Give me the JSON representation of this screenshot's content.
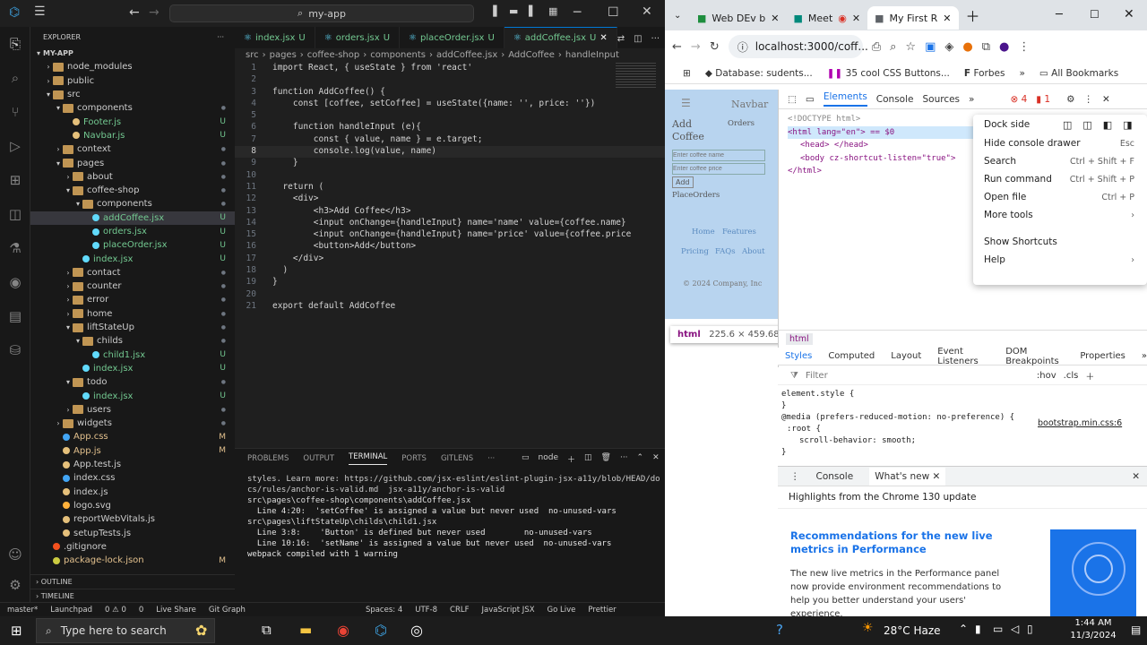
{
  "vscode": {
    "title": "my-app",
    "explorer_label": "EXPLORER",
    "root": "MY-APP",
    "tree": [
      {
        "label": "node_modules",
        "indent": 1,
        "type": "folder",
        "open": false,
        "status": ""
      },
      {
        "label": "public",
        "indent": 1,
        "type": "folder",
        "open": false,
        "status": ""
      },
      {
        "label": "src",
        "indent": 1,
        "type": "folder",
        "open": true,
        "status": ""
      },
      {
        "label": "components",
        "indent": 2,
        "type": "folder",
        "open": true,
        "status": ""
      },
      {
        "label": "Footer.js",
        "indent": 3,
        "type": "js",
        "status": "U"
      },
      {
        "label": "Navbar.js",
        "indent": 3,
        "type": "js",
        "status": "U"
      },
      {
        "label": "context",
        "indent": 2,
        "type": "folder",
        "open": false,
        "status": ""
      },
      {
        "label": "pages",
        "indent": 2,
        "type": "folder",
        "open": true,
        "status": ""
      },
      {
        "label": "about",
        "indent": 3,
        "type": "folder",
        "open": false,
        "status": ""
      },
      {
        "label": "coffee-shop",
        "indent": 3,
        "type": "folder",
        "open": true,
        "status": ""
      },
      {
        "label": "components",
        "indent": 4,
        "type": "folder",
        "open": true,
        "status": ""
      },
      {
        "label": "addCoffee.jsx",
        "indent": 5,
        "type": "jsx",
        "status": "U",
        "selected": true
      },
      {
        "label": "orders.jsx",
        "indent": 5,
        "type": "jsx",
        "status": "U"
      },
      {
        "label": "placeOrder.jsx",
        "indent": 5,
        "type": "jsx",
        "status": "U"
      },
      {
        "label": "index.jsx",
        "indent": 4,
        "type": "jsx",
        "status": "U"
      },
      {
        "label": "contact",
        "indent": 3,
        "type": "folder",
        "open": false,
        "status": ""
      },
      {
        "label": "counter",
        "indent": 3,
        "type": "folder",
        "open": false,
        "status": ""
      },
      {
        "label": "error",
        "indent": 3,
        "type": "folder",
        "open": false,
        "status": ""
      },
      {
        "label": "home",
        "indent": 3,
        "type": "folder",
        "open": false,
        "status": ""
      },
      {
        "label": "liftStateUp",
        "indent": 3,
        "type": "folder",
        "open": true,
        "status": ""
      },
      {
        "label": "childs",
        "indent": 4,
        "type": "folder",
        "open": true,
        "status": ""
      },
      {
        "label": "child1.jsx",
        "indent": 5,
        "type": "jsx",
        "status": "U"
      },
      {
        "label": "index.jsx",
        "indent": 4,
        "type": "jsx",
        "status": "U"
      },
      {
        "label": "todo",
        "indent": 3,
        "type": "folder",
        "open": true,
        "status": ""
      },
      {
        "label": "index.jsx",
        "indent": 4,
        "type": "jsx",
        "status": "U"
      },
      {
        "label": "users",
        "indent": 3,
        "type": "folder",
        "open": false,
        "status": ""
      },
      {
        "label": "widgets",
        "indent": 2,
        "type": "folder",
        "open": false,
        "status": ""
      },
      {
        "label": "App.css",
        "indent": 2,
        "type": "css",
        "status": "M"
      },
      {
        "label": "App.js",
        "indent": 2,
        "type": "js",
        "status": "M"
      },
      {
        "label": "App.test.js",
        "indent": 2,
        "type": "js",
        "status": ""
      },
      {
        "label": "index.css",
        "indent": 2,
        "type": "css",
        "status": ""
      },
      {
        "label": "index.js",
        "indent": 2,
        "type": "js",
        "status": ""
      },
      {
        "label": "logo.svg",
        "indent": 2,
        "type": "svg",
        "status": ""
      },
      {
        "label": "reportWebVitals.js",
        "indent": 2,
        "type": "js",
        "status": ""
      },
      {
        "label": "setupTests.js",
        "indent": 2,
        "type": "js",
        "status": ""
      },
      {
        "label": ".gitignore",
        "indent": 1,
        "type": "git",
        "status": ""
      },
      {
        "label": "package-lock.json",
        "indent": 1,
        "type": "json",
        "status": "M"
      }
    ],
    "outline": "OUTLINE",
    "timeline": "TIMELINE",
    "tabs": [
      {
        "label": "index.jsx",
        "status": "U",
        "active": false
      },
      {
        "label": "orders.jsx",
        "status": "U",
        "active": false
      },
      {
        "label": "placeOrder.jsx",
        "status": "U",
        "active": false
      },
      {
        "label": "addCoffee.jsx",
        "status": "U",
        "active": true
      }
    ],
    "breadcrumbs": [
      "src",
      "pages",
      "coffee-shop",
      "components",
      "addCoffee.jsx",
      "AddCoffee",
      "handleInput"
    ],
    "code": [
      "import React, { useState } from 'react'",
      "",
      "function AddCoffee() {",
      "    const [coffee, setCoffee] = useState({name: '', price: ''})",
      "",
      "    function handleInput (e){",
      "        const { value, name } = e.target;",
      "        console.log(value, name)",
      "    }",
      "",
      "  return (",
      "    <div>",
      "        <h3>Add Coffee</h3>",
      "        <input onChange={handleInput} name='name' value={coffee.name}",
      "        <input onChange={handleInput} name='price' value={coffee.price",
      "        <button>Add</button>",
      "    </div>",
      "  )",
      "}",
      "",
      "export default AddCoffee"
    ],
    "panel_tabs": [
      "PROBLEMS",
      "OUTPUT",
      "TERMINAL",
      "PORTS",
      "GITLENS"
    ],
    "terminal_shell": "node",
    "terminal_lines": [
      "styles. Learn more: https://github.com/jsx-eslint/eslint-plugin-jsx-a11y/blob/HEAD/do",
      "cs/rules/anchor-is-valid.md  jsx-a11y/anchor-is-valid",
      "",
      "src\\pages\\coffee-shop\\components\\addCoffee.jsx",
      "  Line 4:20:  'setCoffee' is assigned a value but never used  no-unused-vars",
      "",
      "src\\pages\\liftStateUp\\childs\\child1.jsx",
      "  Line 3:8:    'Button' is defined but never used        no-unused-vars",
      "  Line 10:16:  'setName' is assigned a value but never used  no-unused-vars",
      "",
      "webpack compiled with 1 warning"
    ],
    "status": [
      "master*",
      "Launchpad",
      "0 ⚠ 0",
      "0",
      "Live Share",
      "Git Graph",
      "Spaces: 4",
      "UTF-8",
      "CRLF",
      "JavaScript JSX",
      "Go Live",
      "Prettier"
    ]
  },
  "chrome": {
    "tabs": [
      {
        "label": "Web DEv b",
        "active": false,
        "color": "#1e8e3e"
      },
      {
        "label": "Meet",
        "active": false,
        "color": "#00897b"
      },
      {
        "label": "My First R",
        "active": true,
        "color": "#5f6368"
      }
    ],
    "url": "localhost:3000/coff...",
    "bookmarks": [
      "Database: sudents...",
      "35 cool CSS Buttons...",
      "Forbes",
      "All Bookmarks"
    ],
    "app_page": {
      "navbar": "Navbar",
      "add_heading": "Add Coffee",
      "orders": "Orders",
      "name_placeholder": "Enter coffee name",
      "price_placeholder": "Enter coffee price",
      "add_button": "Add",
      "place_orders": "PlaceOrders",
      "footer_links": [
        "Home",
        "Features",
        "Pricing",
        "FAQs",
        "About"
      ],
      "copyright": "© 2024 Company, Inc"
    },
    "inspect_tip": {
      "tag": "html",
      "size": "225.6 × 459.68"
    },
    "devtools": {
      "tabs": [
        "Elements",
        "Console",
        "Sources"
      ],
      "errors": "4",
      "warnings": "1",
      "dom": [
        "<!DOCTYPE html>",
        "<html lang=\"en\"> == $0",
        "<head> </head>",
        "<body cz-shortcut-listen=\"true\">",
        "</html>"
      ],
      "breadcrumb": "html",
      "style_tabs": [
        "Styles",
        "Computed",
        "Layout",
        "Event Listeners",
        "DOM Breakpoints",
        "Properties"
      ],
      "filter_placeholder": "Filter",
      "hov": ":hov",
      "cls": ".cls",
      "styles": [
        "element.style {",
        "}",
        "@media (prefers-reduced-motion: no-preference) {",
        ":root {",
        "scroll-behavior: smooth;",
        "}"
      ],
      "style_source": "bootstrap.min.css:6",
      "drawer_tabs": [
        "Console",
        "What's new"
      ],
      "drawer_headline": "Highlights from the Chrome 130 update",
      "drawer_title": "Recommendations for the new live metrics in Performance",
      "drawer_body": "The new live metrics in the Performance panel now provide environment recommendations to help you better understand your users' experience."
    },
    "menu": {
      "dock_side": "Dock side",
      "items": [
        {
          "label": "Hide console drawer",
          "shortcut": "Esc"
        },
        {
          "label": "Search",
          "shortcut": "Ctrl + Shift + F"
        },
        {
          "label": "Run command",
          "shortcut": "Ctrl + Shift + P"
        },
        {
          "label": "Open file",
          "shortcut": "Ctrl + P"
        },
        {
          "label": "More tools",
          "shortcut": "›"
        },
        {
          "label": "Show Shortcuts",
          "shortcut": ""
        },
        {
          "label": "Help",
          "shortcut": "›"
        }
      ]
    }
  },
  "taskbar": {
    "search_placeholder": "Type here to search",
    "weather": "28°C Haze",
    "time": "1:44 AM",
    "date": "11/3/2024"
  }
}
